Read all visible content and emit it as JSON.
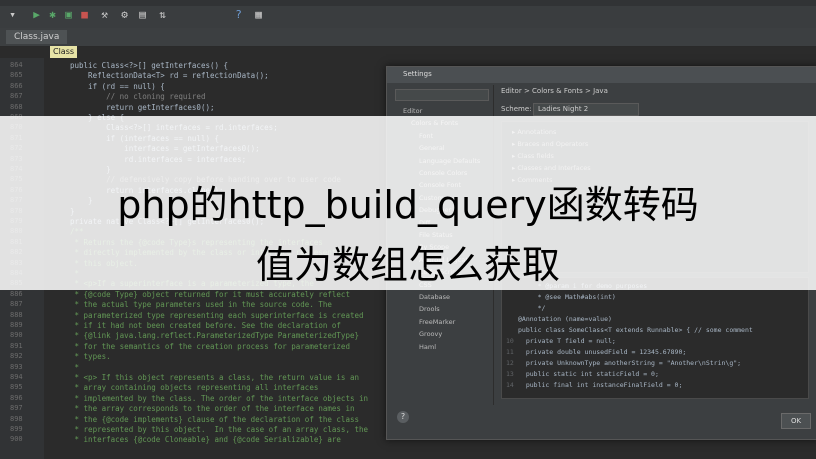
{
  "window": {
    "file_tab": "Class.java",
    "breadcrumb_chip": "Class"
  },
  "toolbar": {
    "icons": [
      "dropdown-icon",
      "run-icon",
      "debug-icon",
      "run-coverage-icon",
      "stop-icon",
      "build-icon",
      "settings-icon",
      "sdk-icon",
      "help-icon",
      "vcs-icon"
    ]
  },
  "editor": {
    "lines": [
      {
        "no": "864",
        "text": "public Class<?>[] getInterfaces() {"
      },
      {
        "no": "865",
        "text": "    ReflectionData<T> rd = reflectionData();"
      },
      {
        "no": "866",
        "text": "    if (rd == null) {"
      },
      {
        "no": "867",
        "text": "        // no cloning required"
      },
      {
        "no": "868",
        "text": "        return getInterfaces0();"
      },
      {
        "no": "869",
        "text": "    } else {"
      },
      {
        "no": "870",
        "text": "        Class<?>[] interfaces = rd.interfaces;"
      },
      {
        "no": "871",
        "text": "        if (interfaces == null) {"
      },
      {
        "no": "872",
        "text": "            interfaces = getInterfaces0();"
      },
      {
        "no": "873",
        "text": "            rd.interfaces = interfaces;"
      },
      {
        "no": "874",
        "text": "        }"
      },
      {
        "no": "875",
        "text": "        // defensively copy before handing over to user code"
      },
      {
        "no": "876",
        "text": "        return interfaces.clone();"
      },
      {
        "no": "877",
        "text": "    }"
      },
      {
        "no": "878",
        "text": "}"
      },
      {
        "no": "879",
        "text": "private native Class<?>[] getInterfaces0();"
      },
      {
        "no": "880",
        "text": "/**"
      },
      {
        "no": "881",
        "text": " * Returns the {@code Type}s representing the interfaces"
      },
      {
        "no": "882",
        "text": " * directly implemented by the class or interface represented by"
      },
      {
        "no": "883",
        "text": " * this object."
      },
      {
        "no": "884",
        "text": " *"
      },
      {
        "no": "885",
        "text": " * <p>If a superinterface is a parameterized type, the"
      },
      {
        "no": "886",
        "text": " * {@code Type} object returned for it must accurately reflect"
      },
      {
        "no": "887",
        "text": " * the actual type parameters used in the source code. The"
      },
      {
        "no": "888",
        "text": " * parameterized type representing each superinterface is created"
      },
      {
        "no": "889",
        "text": " * if it had not been created before. See the declaration of"
      },
      {
        "no": "890",
        "text": " * {@link java.lang.reflect.ParameterizedType ParameterizedType}"
      },
      {
        "no": "891",
        "text": " * for the semantics of the creation process for parameterized"
      },
      {
        "no": "892",
        "text": " * types."
      },
      {
        "no": "893",
        "text": " *"
      },
      {
        "no": "894",
        "text": " * <p> If this object represents a class, the return value is an"
      },
      {
        "no": "895",
        "text": " * array containing objects representing all interfaces"
      },
      {
        "no": "896",
        "text": " * implemented by the class. The order of the interface objects in"
      },
      {
        "no": "897",
        "text": " * the array corresponds to the order of the interface names in"
      },
      {
        "no": "898",
        "text": " * the {@code implements} clause of the declaration of the class"
      },
      {
        "no": "899",
        "text": " * represented by this object.  In the case of an array class, the"
      },
      {
        "no": "900",
        "text": " * interfaces {@code Cloneable} and {@code Serializable} are"
      }
    ]
  },
  "settings_dialog": {
    "title": "Settings",
    "path": "Editor > Colors & Fonts > Java",
    "scheme_label": "Scheme:",
    "scheme_value": "Ladies Night 2",
    "tree": [
      "Editor",
      "Colors & Fonts",
      "Font",
      "General",
      "Language Defaults",
      "Console Colors",
      "Console Font",
      "Custom",
      "Debugger",
      "Diff",
      "File Status",
      "By Scope",
      "Android Logcat",
      "CoffeeScript",
      "CSS",
      "Database",
      "Drools",
      "FreeMarker",
      "Groovy",
      "Haml"
    ],
    "attributes": [
      "Annotations",
      "Braces and Operators",
      "Class fields",
      "Classes and Interfaces",
      "Comments"
    ],
    "preview_lines": [
      {
        "no": "",
        "text": "     * @param i for demo purposes"
      },
      {
        "no": "",
        "text": "     * @see Math#abs(int)"
      },
      {
        "no": "",
        "text": "     */"
      },
      {
        "no": "",
        "text": "@Annotation (name=value)"
      },
      {
        "no": "",
        "text": "public class SomeClass<T extends Runnable> { // some comment"
      },
      {
        "no": "10",
        "text": "  private T field = null;"
      },
      {
        "no": "11",
        "text": "  private double unusedField = 12345.67890;"
      },
      {
        "no": "12",
        "text": "  private UnknownType anotherString = \"Another\\nStrin\\g\";"
      },
      {
        "no": "13",
        "text": "  public static int staticField = 0;"
      },
      {
        "no": "14",
        "text": "  public final int instanceFinalField = 0;"
      }
    ],
    "help_label": "?",
    "ok_label": "OK"
  },
  "banner": {
    "line1": "php的http_build_query函数转码",
    "line2": "值为数组怎么获取"
  }
}
